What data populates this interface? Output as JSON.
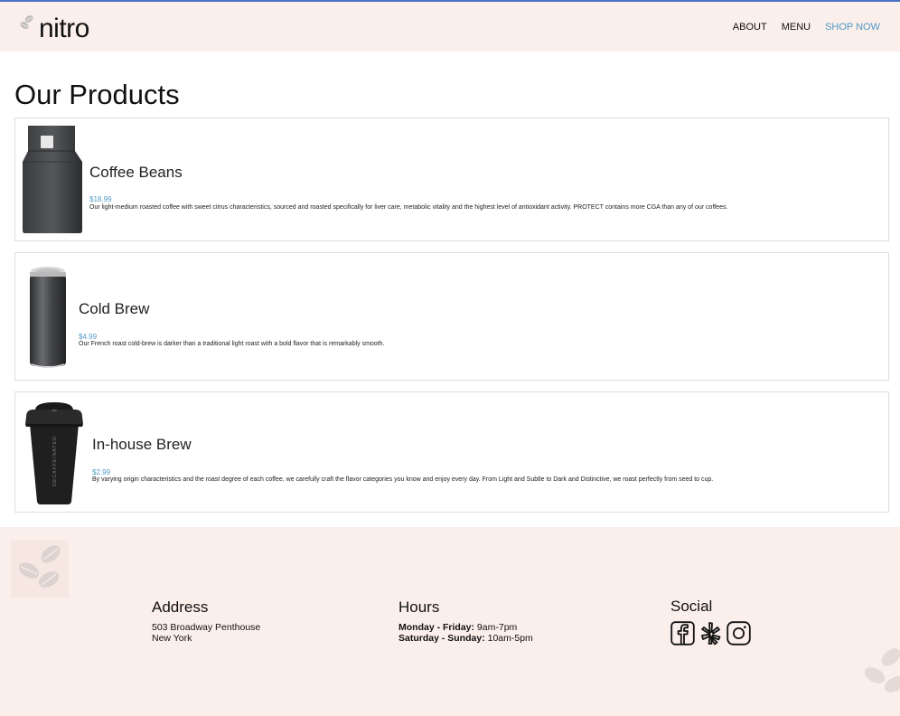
{
  "header": {
    "logo_text": "nitro",
    "nav": [
      {
        "label": "ABOUT"
      },
      {
        "label": "MENU"
      },
      {
        "label": "SHOP NOW"
      }
    ]
  },
  "page_title": "Our Products",
  "products": [
    {
      "name": "Coffee Beans",
      "price": "$18.99",
      "description": "Our light-medium roasted coffee with sweet citrus characteristics, sourced and roasted specifically for liver care, metabolic vitality and the highest level of antioxidant activity. PROTECT contains more CGA than any of our coffees.",
      "image_icon": "coffee-bag-icon"
    },
    {
      "name": "Cold Brew",
      "price": "$4.99",
      "description": "Our French roast cold-brew is darker than a traditional light roast with a bold flavor that is remarkably smooth.",
      "image_icon": "can-icon"
    },
    {
      "name": "In-house Brew",
      "price": "$2.99",
      "description": "By varying origin characteristics and the roast degree of each coffee, we carefully craft the flavor categories you know and enjoy every day. From Light and Subtle to Dark and Distinctive, we roast perfectly from seed to cup.",
      "image_icon": "coffee-cup-icon",
      "cup_label": "DECAFFEINATED"
    }
  ],
  "footer": {
    "address": {
      "title": "Address",
      "line1": "503 Broadway Penthouse",
      "line2": "New York"
    },
    "hours": {
      "title": "Hours",
      "row1_label": "Monday - Friday:",
      "row1_value": " 9am-7pm",
      "row2_label": "Saturday - Sunday:",
      "row2_value": " 10am-5pm"
    },
    "social": {
      "title": "Social",
      "icons": [
        "facebook-icon",
        "yelp-icon",
        "instagram-icon"
      ]
    }
  },
  "colors": {
    "accent": "#4f9bc4",
    "header_bg": "#fbefec",
    "top_border": "#4a72c4"
  }
}
